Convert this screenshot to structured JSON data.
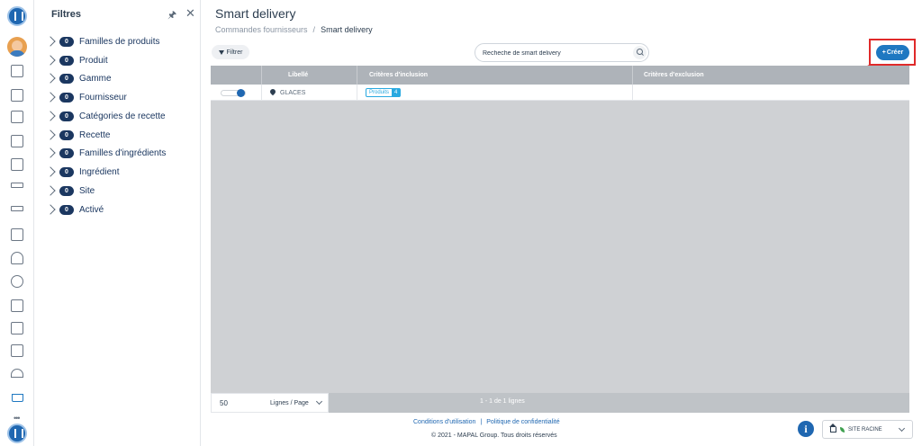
{
  "filters": {
    "title": "Filtres",
    "items": [
      {
        "count": "0",
        "label": "Familles de produits"
      },
      {
        "count": "0",
        "label": "Produit"
      },
      {
        "count": "0",
        "label": "Gamme"
      },
      {
        "count": "0",
        "label": "Fournisseur"
      },
      {
        "count": "0",
        "label": "Catégories de recette"
      },
      {
        "count": "0",
        "label": "Recette"
      },
      {
        "count": "0",
        "label": "Familles d'ingrédients"
      },
      {
        "count": "0",
        "label": "Ingrédient"
      },
      {
        "count": "0",
        "label": "Site"
      },
      {
        "count": "0",
        "label": "Activé"
      }
    ]
  },
  "header": {
    "title": "Smart delivery",
    "breadcrumb": [
      "Commandes fournisseurs",
      "Smart delivery"
    ],
    "separator": "/"
  },
  "toolbar": {
    "filter_label": "Filtrer",
    "search_placeholder": "Recheche de smart delivery",
    "create_label": "Créer"
  },
  "table": {
    "columns": [
      "Libellé",
      "Critères d'inclusion",
      "Critères d'exclusion"
    ],
    "rows": [
      {
        "active": true,
        "libelle": "GLACES",
        "inclusion_label": "Produits",
        "inclusion_count": "4",
        "exclusion": ""
      }
    ]
  },
  "pagination": {
    "page_size": "50",
    "page_size_label": "Lignes / Page",
    "info": "1 - 1 de 1 lignes"
  },
  "footer": {
    "terms": "Conditions d'utilisation",
    "separator": "|",
    "privacy": "Politique de confidentialité",
    "copyright": "© 2021 - MAPAL Group. Tous droits réservés",
    "site": "SITE RACINE"
  },
  "colors": {
    "brand": "#1f67b1",
    "accent": "#1f78c1",
    "badge": "#1b3760",
    "highlight": "#e02a2a",
    "tag": "#29a9e0"
  }
}
